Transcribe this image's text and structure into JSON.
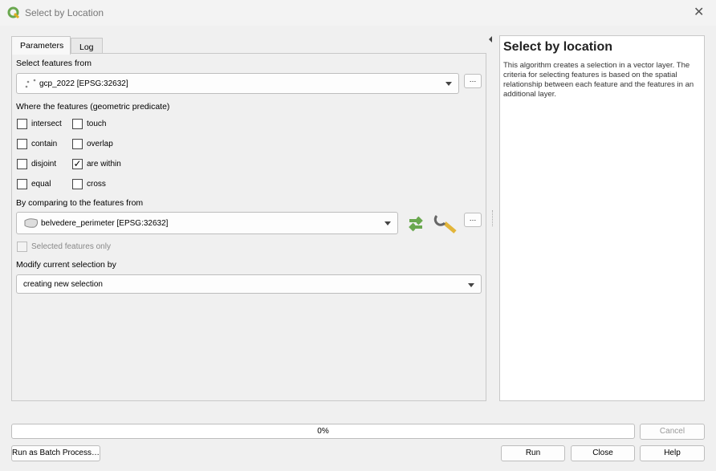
{
  "window": {
    "title": "Select by Location",
    "close": "✕"
  },
  "tabs": [
    {
      "label": "Parameters",
      "active": true
    },
    {
      "label": "Log",
      "active": false
    }
  ],
  "params": {
    "select_from_label": "Select features from",
    "select_from_value": "gcp_2022 [EPSG:32632]",
    "predicate_label": "Where the features (geometric predicate)",
    "predicates": [
      {
        "label": "intersect",
        "checked": false
      },
      {
        "label": "touch",
        "checked": false
      },
      {
        "label": "contain",
        "checked": false
      },
      {
        "label": "overlap",
        "checked": false
      },
      {
        "label": "disjoint",
        "checked": false
      },
      {
        "label": "are within",
        "checked": true
      },
      {
        "label": "equal",
        "checked": false
      },
      {
        "label": "cross",
        "checked": false
      }
    ],
    "compare_label": "By comparing to the features from",
    "compare_value": "belvedere_perimeter [EPSG:32632]",
    "selected_only_label": "Selected features only",
    "modify_label": "Modify current selection by",
    "modify_value": "creating new selection",
    "dots": "…"
  },
  "help": {
    "title": "Select by location",
    "text": "This algorithm creates a selection in a vector layer. The criteria for selecting features is based on the spatial relationship between each feature and the features in an additional layer."
  },
  "progress": {
    "value": 0,
    "label": "0%"
  },
  "buttons": {
    "cancel": "Cancel",
    "batch": "Run as Batch Process…",
    "run": "Run",
    "close": "Close",
    "help": "Help"
  },
  "colors": {
    "accent": "#6aa84f"
  }
}
